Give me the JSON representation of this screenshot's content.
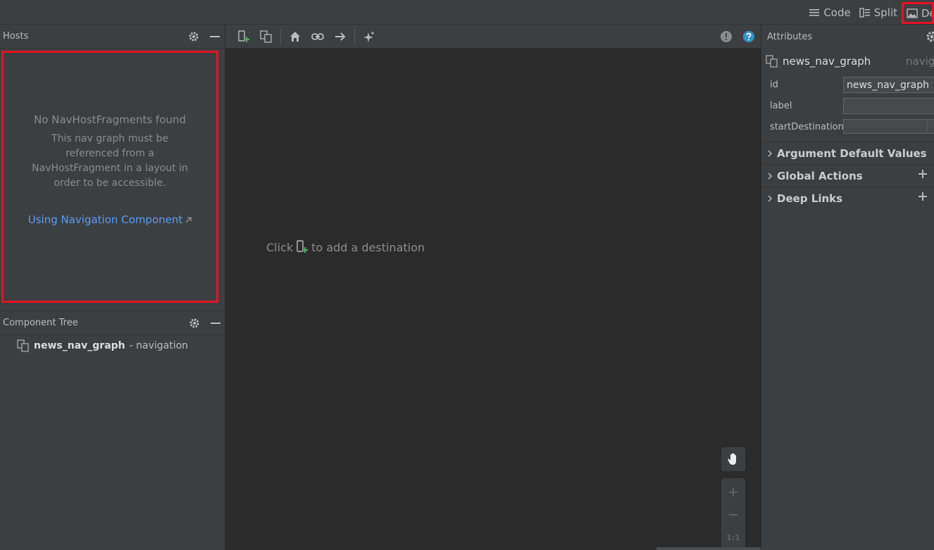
{
  "view_modes": {
    "code": "Code",
    "split": "Split",
    "design": "De"
  },
  "hosts": {
    "title": "Hosts",
    "empty_title": "No NavHostFragments found",
    "empty_desc": "This nav graph must be referenced from a NavHostFragment in a layout in order to be accessible.",
    "link": "Using Navigation Component"
  },
  "component_tree": {
    "title": "Component Tree",
    "root_name": "news_nav_graph",
    "root_type": "- navigation"
  },
  "canvas": {
    "hint_before": "Click",
    "hint_after": "to add a destination",
    "zoom_reset": "1:1"
  },
  "attributes": {
    "title": "Attributes",
    "component_name": "news_nav_graph",
    "component_type": "navigation",
    "fields": {
      "id_label": "id",
      "id_value": "news_nav_graph",
      "label_label": "label",
      "label_value": "",
      "start_label": "startDestination"
    },
    "sections": {
      "arg_defaults": "Argument Default Values",
      "global_actions": "Global Actions",
      "deep_links": "Deep Links"
    }
  },
  "colors": {
    "highlight": "#e81123",
    "link": "#589df6",
    "add_green": "#59a869",
    "help": "#3592c4"
  }
}
